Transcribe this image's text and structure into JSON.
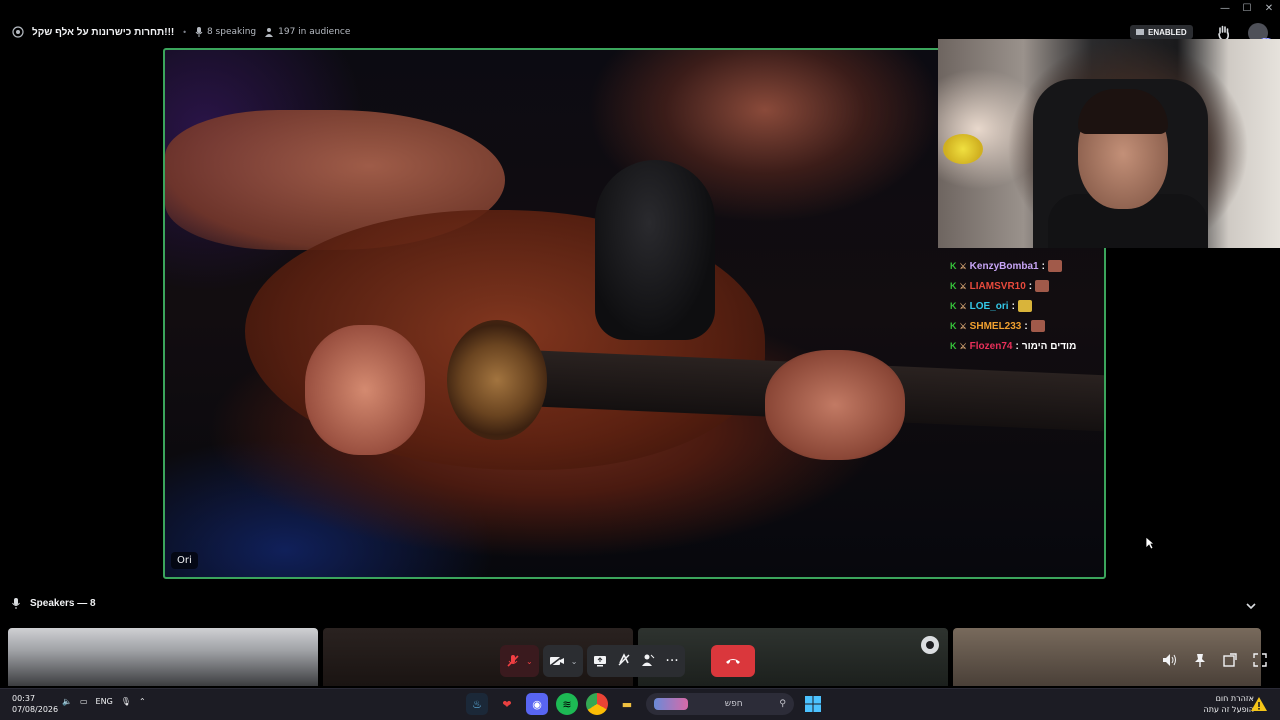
{
  "window": {
    "minimize": "—",
    "maximize": "☐",
    "close": "✕"
  },
  "header": {
    "channel_name": "תחרות כישרונות על אלף שקל!!!",
    "speaking": "8 speaking",
    "audience": "197 in audience",
    "enabled_badge": "ENABLED",
    "avatar_badge": "72"
  },
  "stage": {
    "name_tag": "Ori"
  },
  "chat": [
    {
      "user": "KenzyBomba1",
      "color": "#c7a4f5",
      "emote": "brown"
    },
    {
      "user": "LIAMSVR10",
      "color": "#e84a3c",
      "emote": "brown"
    },
    {
      "user": "LOE_ori",
      "color": "#34c8e8",
      "emote": "yellow"
    },
    {
      "user": "SHMEL233",
      "color": "#f0a030",
      "emote": "brown"
    },
    {
      "user": "Flozen74",
      "color": "#e8305a",
      "message": "מודים הימור"
    }
  ],
  "speakers": {
    "label": "Speakers — 8"
  },
  "taskbar": {
    "time": "00:37",
    "date": "07/08/2026",
    "language": "ENG",
    "search_placeholder": "חפש",
    "weather_title": "אזהרת חום",
    "weather_subtitle": "הופעל זה עתה",
    "weather_badge": "2"
  },
  "colors": {
    "speaking_border": "#3ba55c",
    "end_call": "#da373c",
    "mute_active": "#f23f43",
    "taskbar": "#1c1c24"
  }
}
